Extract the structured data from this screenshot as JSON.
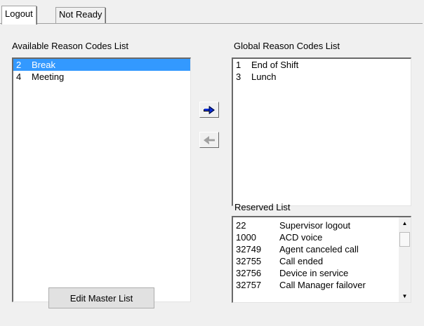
{
  "tabs": [
    {
      "label": "Logout",
      "active": true
    },
    {
      "label": "Not Ready",
      "active": false
    }
  ],
  "available": {
    "label": "Available Reason Codes List",
    "items": [
      {
        "code": "2",
        "desc": "Break",
        "selected": true
      },
      {
        "code": "4",
        "desc": "Meeting",
        "selected": false
      }
    ]
  },
  "global": {
    "label": "Global Reason Codes List",
    "items": [
      {
        "code": "1",
        "desc": "End of Shift"
      },
      {
        "code": "3",
        "desc": "Lunch"
      }
    ]
  },
  "reserved": {
    "label": "Reserved List",
    "items": [
      {
        "code": "22",
        "desc": "Supervisor logout"
      },
      {
        "code": "1000",
        "desc": "ACD voice"
      },
      {
        "code": "32749",
        "desc": "Agent canceled call"
      },
      {
        "code": "32755",
        "desc": "Call ended"
      },
      {
        "code": "32756",
        "desc": "Device in service"
      },
      {
        "code": "32757",
        "desc": "Call Manager failover"
      }
    ]
  },
  "buttons": {
    "edit_master": "Edit Master List"
  },
  "icons": {
    "move_right": "arrow-right-icon",
    "move_left": "arrow-left-icon"
  },
  "colors": {
    "selection": "#3399ff",
    "arrow_active": "#0a2dd8",
    "arrow_disabled": "#a0a0a0"
  }
}
